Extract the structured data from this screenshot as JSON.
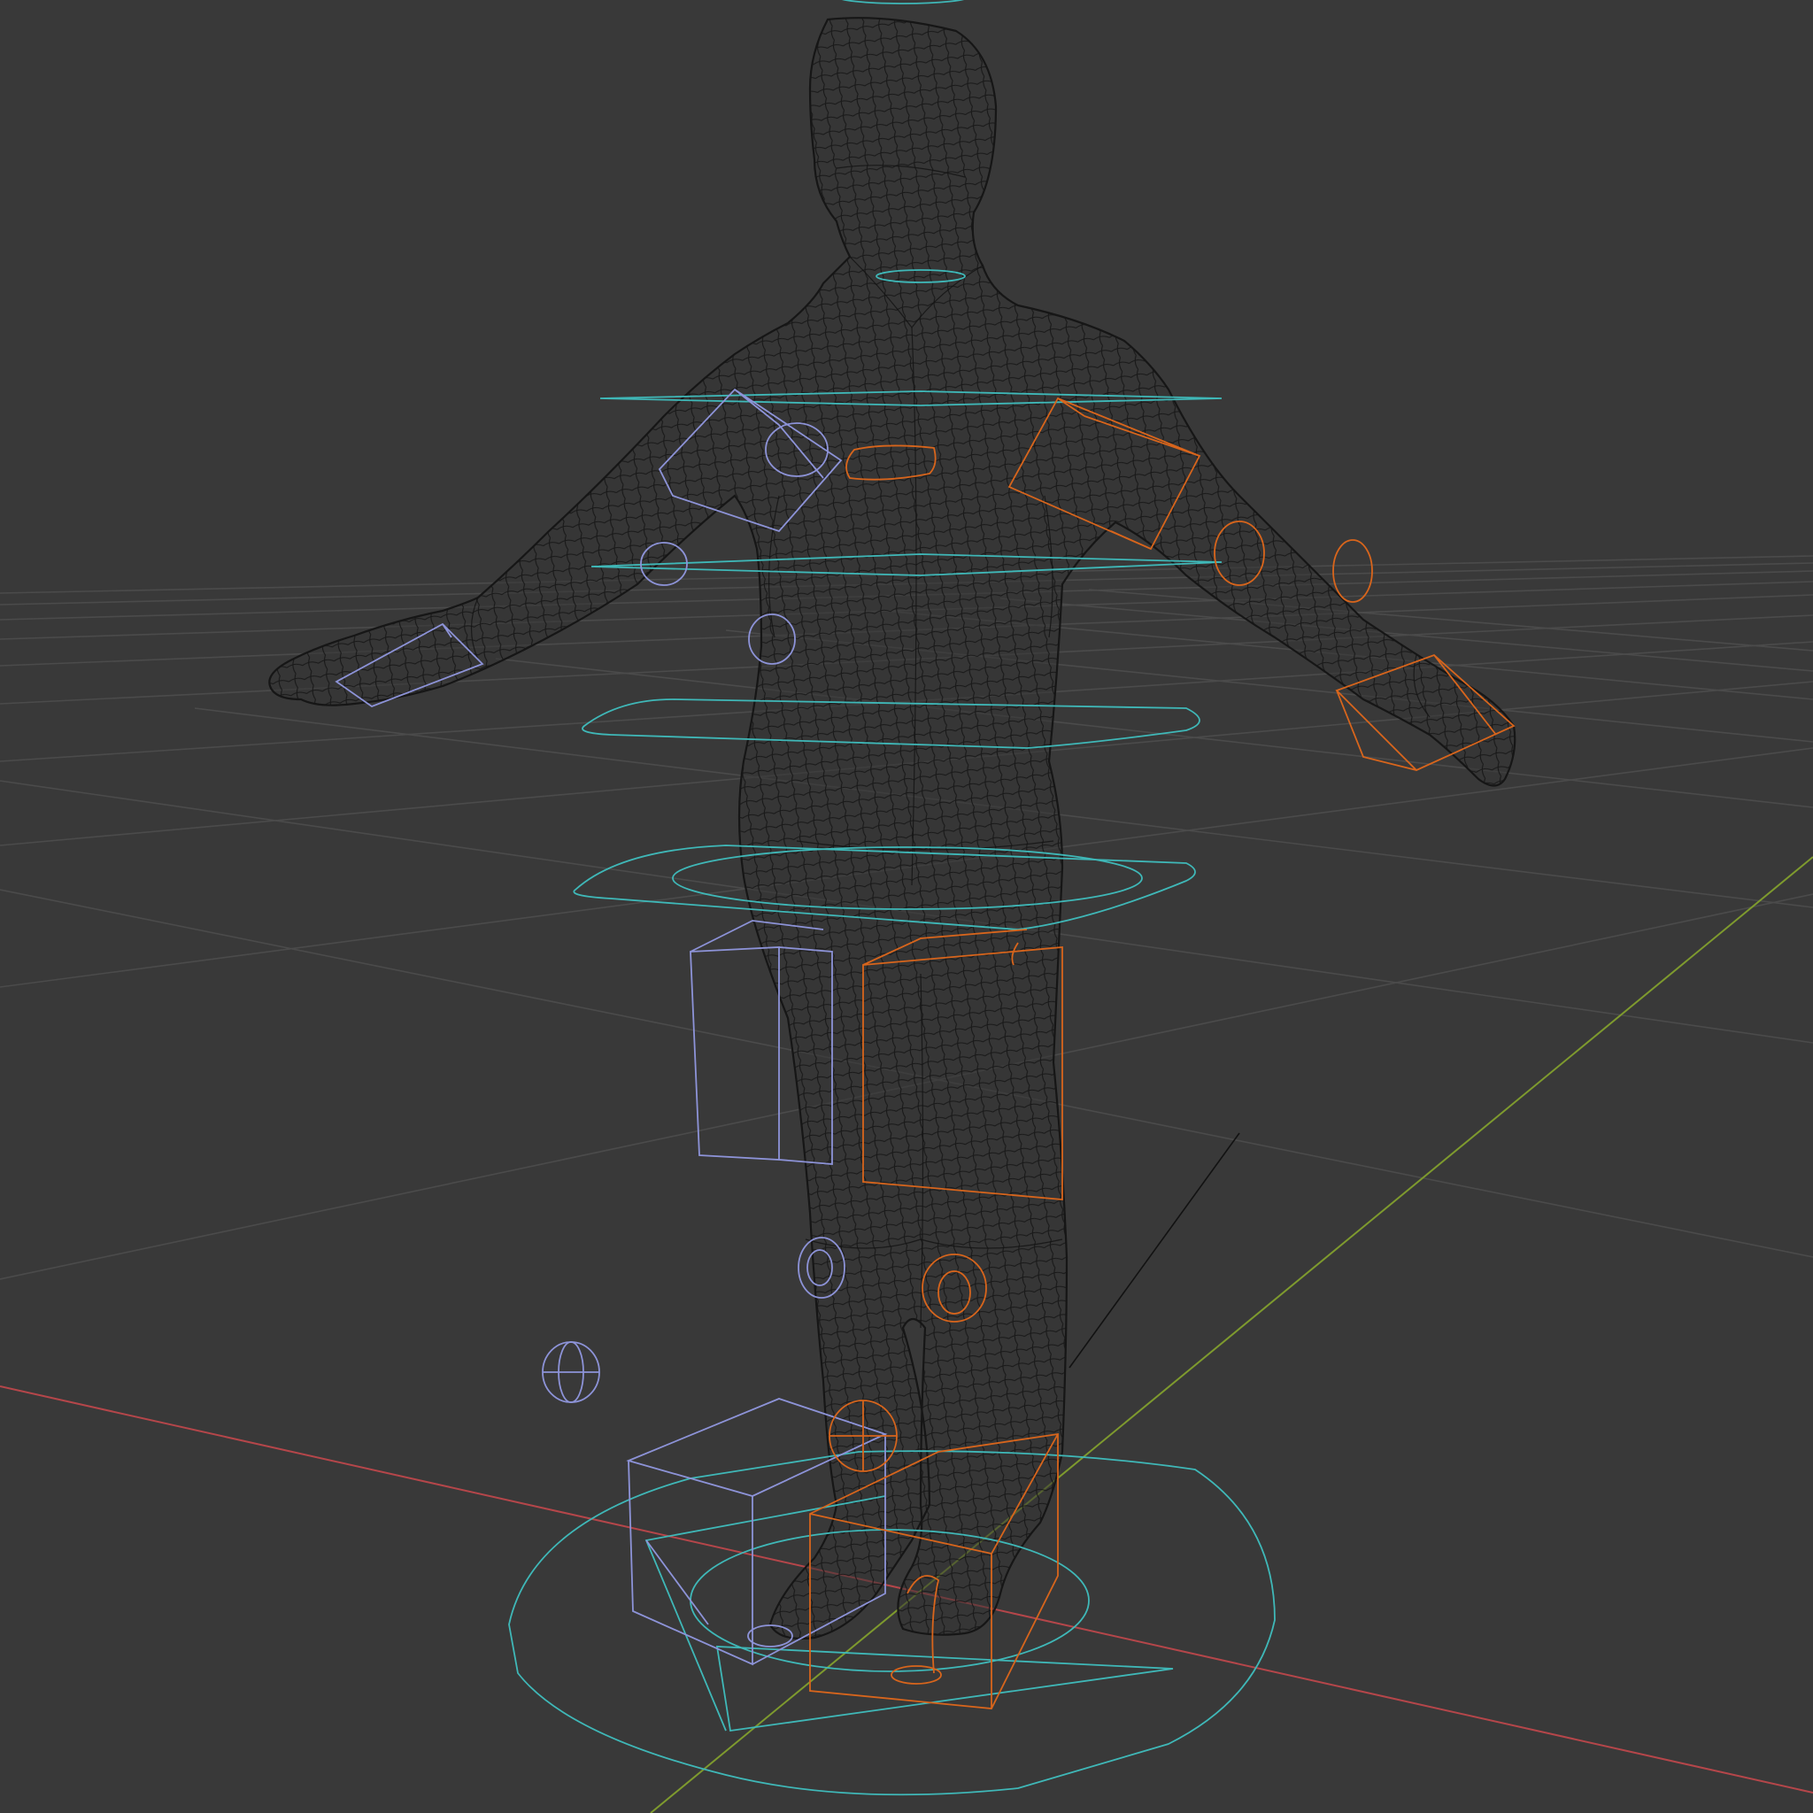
{
  "viewport": {
    "background": "#393939",
    "mode": "wireframe"
  },
  "colors": {
    "grid": "#4b4b4b",
    "x_axis": "#b5464a",
    "y_axis": "#7e9a2e",
    "mesh_wire": "#141414",
    "controls_center": "#3fb8b8",
    "controls_left": "#8d93d8",
    "controls_right": "#d8651c"
  },
  "scene": {
    "object": "character-mesh",
    "rig_controls": [
      "root-circle-control",
      "torso-controls",
      "neck-control",
      "arm-ik-controls-left",
      "arm-ik-controls-right",
      "leg-ik-controls-left",
      "leg-ik-controls-right",
      "foot-controls-left",
      "foot-controls-right"
    ]
  }
}
